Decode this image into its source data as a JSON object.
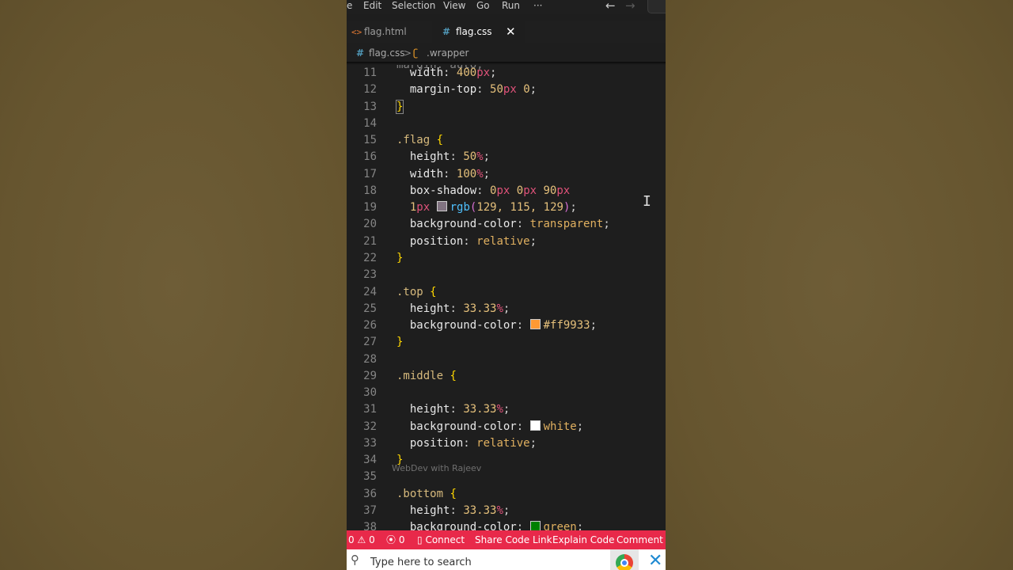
{
  "menu": {
    "items": [
      "e",
      "Edit",
      "Selection",
      "View",
      "Go",
      "Run",
      "···"
    ],
    "back_icon": "arrow-left-icon",
    "forward_icon": "arrow-right-icon"
  },
  "tabs": [
    {
      "label": "flag.html",
      "icon": "html-file-icon",
      "active": false
    },
    {
      "label": "flag.css",
      "icon": "css-file-icon",
      "active": true,
      "close": "✕"
    }
  ],
  "breadcrumbs": {
    "file": "flag.css",
    "separator": ">",
    "symbol": ".wrapper"
  },
  "editor": {
    "lines": [
      {
        "n": "11",
        "code": "  width: 400px;"
      },
      {
        "n": "12",
        "code": "  margin-top: 50px 0;"
      },
      {
        "n": "13",
        "code": "}"
      },
      {
        "n": "14",
        "code": ""
      },
      {
        "n": "15",
        "code": ".flag {"
      },
      {
        "n": "16",
        "code": "  height: 50%;"
      },
      {
        "n": "17",
        "code": "  width: 100%;"
      },
      {
        "n": "18",
        "code": "  box-shadow: 0px 0px 90px"
      },
      {
        "n": "19",
        "code": "  1px rgb(129, 115, 129);"
      },
      {
        "n": "20",
        "code": "  background-color: transparent;"
      },
      {
        "n": "21",
        "code": "  position: relative;"
      },
      {
        "n": "22",
        "code": "}"
      },
      {
        "n": "23",
        "code": ""
      },
      {
        "n": "24",
        "code": ".top {"
      },
      {
        "n": "25",
        "code": "  height: 33.33%;"
      },
      {
        "n": "26",
        "code": "  background-color: #ff9933;"
      },
      {
        "n": "27",
        "code": "}"
      },
      {
        "n": "28",
        "code": ""
      },
      {
        "n": "29",
        "code": ".middle {"
      },
      {
        "n": "30",
        "code": ""
      },
      {
        "n": "31",
        "code": "  height: 33.33%;"
      },
      {
        "n": "32",
        "code": "  background-color: white;"
      },
      {
        "n": "33",
        "code": "  position: relative;"
      },
      {
        "n": "34",
        "code": "}"
      },
      {
        "n": "35",
        "code": ""
      },
      {
        "n": "36",
        "code": ".bottom {"
      },
      {
        "n": "37",
        "code": "  height: 33.33%;"
      },
      {
        "n": "38",
        "code": "  background-color: green;"
      }
    ],
    "swatch_colors": {
      "rgb": "#817381",
      "orange": "#ff9933",
      "white": "#ffffff",
      "green": "#008000"
    }
  },
  "watermark": "WebDev with Rajeev",
  "status": {
    "problems": "0",
    "warnings": "0",
    "ports": "0",
    "connect": "Connect",
    "share": "Share Code Link",
    "explain": "Explain Code",
    "comment": "Comment Co"
  },
  "taskbar": {
    "search_placeholder": "Type here to search"
  },
  "colors": {
    "status_bar": "#e8294a",
    "editor_bg": "#1e1e1e"
  }
}
